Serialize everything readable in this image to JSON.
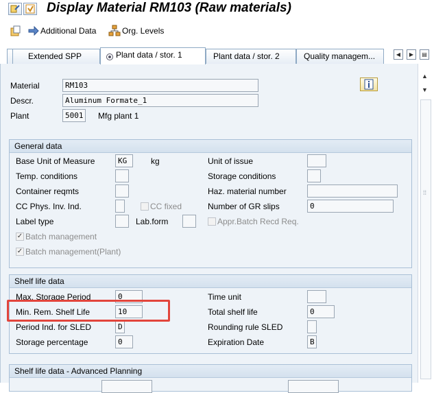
{
  "window": {
    "title": "Display Material RM103 (Raw materials)"
  },
  "toolbar": {
    "additional_data": "Additional Data",
    "org_levels": "Org. Levels"
  },
  "tabs": [
    {
      "label": "Extended SPP",
      "active": false
    },
    {
      "label": "Plant data / stor. 1",
      "active": true
    },
    {
      "label": "Plant data / stor. 2",
      "active": false
    },
    {
      "label": "Quality managem...",
      "active": false
    }
  ],
  "header": {
    "material_label": "Material",
    "material_value": "RM103",
    "descr_label": "Descr.",
    "descr_value": "Aluminum Formate_1",
    "plant_label": "Plant",
    "plant_value": "5001",
    "plant_name": "Mfg plant 1"
  },
  "general_data": {
    "title": "General data",
    "base_uom_label": "Base Unit of Measure",
    "base_uom_value": "KG",
    "base_uom_text": "kg",
    "unit_of_issue_label": "Unit of issue",
    "unit_of_issue_value": "",
    "temp_conditions_label": "Temp. conditions",
    "temp_conditions_value": "",
    "storage_conditions_label": "Storage conditions",
    "storage_conditions_value": "",
    "container_reqmts_label": "Container reqmts",
    "container_reqmts_value": "",
    "haz_material_label": "Haz. material number",
    "haz_material_value": "",
    "cc_phys_inv_label": "CC Phys. Inv. Ind.",
    "cc_phys_inv_value": "",
    "cc_fixed_label": "CC fixed",
    "cc_fixed_checked": false,
    "num_gr_slips_label": "Number of GR slips",
    "num_gr_slips_value": "0",
    "label_type_label": "Label type",
    "label_type_value": "",
    "lab_form_label": "Lab.form",
    "lab_form_value": "",
    "appr_batch_label": "Appr.Batch Recd Req.",
    "appr_batch_checked": false,
    "batch_mgmt_label": "Batch management",
    "batch_mgmt_checked": true,
    "batch_mgmt_plant_label": "Batch management(Plant)",
    "batch_mgmt_plant_checked": true
  },
  "shelf_life": {
    "title": "Shelf life data",
    "max_storage_label": "Max. Storage Period",
    "max_storage_value": "0",
    "time_unit_label": "Time unit",
    "time_unit_value": "",
    "min_rem_label": "Min. Rem. Shelf Life",
    "min_rem_value": "10",
    "total_shelf_label": "Total shelf life",
    "total_shelf_value": "0",
    "period_ind_label": "Period Ind. for SLED",
    "period_ind_value": "D",
    "rounding_label": "Rounding rule SLED",
    "rounding_value": "",
    "storage_pct_label": "Storage percentage",
    "storage_pct_value": "0",
    "expiration_label": "Expiration Date",
    "expiration_value": "B"
  },
  "shelf_life_adv": {
    "title": "Shelf life data - Advanced Planning"
  },
  "colors": {
    "highlight": "#e2453c",
    "panel_bg": "#eef3f8",
    "group_header": "#d4e1ee"
  }
}
